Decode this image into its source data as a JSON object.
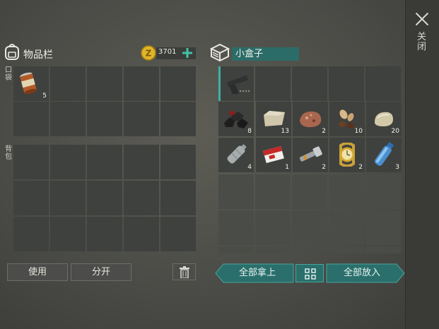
{
  "inventory": {
    "title": "物品栏",
    "pocket_label": "口袋",
    "backpack_label": "背包",
    "coins": "3701"
  },
  "pocket_items": [
    {
      "name": "canned-food",
      "count": "5"
    }
  ],
  "container": {
    "title": "小盒子",
    "items": [
      {
        "name": "pistol",
        "count": ""
      },
      {
        "name": "coal",
        "count": "8"
      },
      {
        "name": "stone-block",
        "count": "13"
      },
      {
        "name": "ore",
        "count": "2"
      },
      {
        "name": "seeds",
        "count": "10"
      },
      {
        "name": "rock",
        "count": "20"
      },
      {
        "name": "empty-bottle",
        "count": "4"
      },
      {
        "name": "cigarette-pack",
        "count": "1"
      },
      {
        "name": "flashlight",
        "count": "2"
      },
      {
        "name": "gold-watch",
        "count": "2"
      },
      {
        "name": "water-bottle",
        "count": "3"
      }
    ]
  },
  "buttons": {
    "use": "使用",
    "split": "分开",
    "take_all": "全部拿上",
    "put_all": "全部放入",
    "close": "关闭"
  },
  "icons": {
    "backpack": "backpack-icon",
    "coin": "coin-icon",
    "add": "plus-icon",
    "box": "box-icon",
    "trash": "trash-icon",
    "grid": "grid-sort-icon",
    "close": "close-icon"
  },
  "colors": {
    "accent_teal": "#2a6f6b",
    "coin_gold": "#e0b52a",
    "plus_green": "#3fc3a6"
  }
}
